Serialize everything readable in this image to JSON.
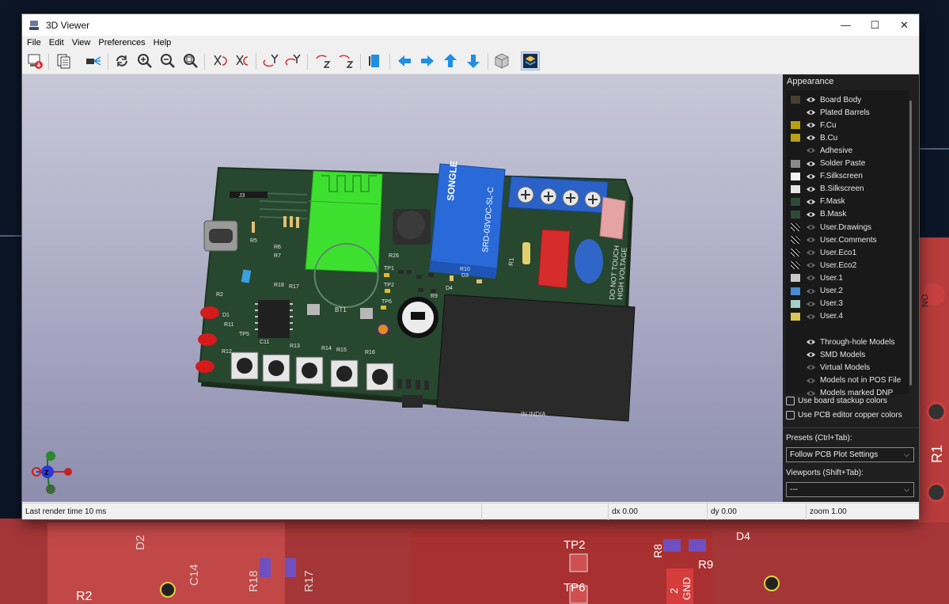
{
  "window": {
    "title": "3D Viewer",
    "minimize": "—",
    "maximize": "☐",
    "close": "✕"
  },
  "menu": [
    "File",
    "Edit",
    "View",
    "Preferences",
    "Help"
  ],
  "toolbar": {
    "icons": [
      "render-raytrace-icon",
      "copy-icon",
      "camera-icon",
      "reload-icon",
      "zoom-in-icon",
      "zoom-out-icon",
      "zoom-fit-icon",
      "rotate-x-cw-icon",
      "rotate-x-ccw-icon",
      "rotate-y-cw-icon",
      "rotate-y-ccw-icon",
      "rotate-z-cw-icon",
      "rotate-z-ccw-icon",
      "flip-board-icon",
      "pan-left-icon",
      "pan-right-icon",
      "pan-up-icon",
      "pan-down-icon",
      "ortho-icon",
      "layers-toggle-icon"
    ],
    "accent": "#1f8fe6"
  },
  "appearance": {
    "title": "Appearance",
    "layers": [
      {
        "label": "Board Body",
        "color": "#4a3f2f"
      },
      {
        "label": "Plated Barrels",
        "color": ""
      },
      {
        "label": "F.Cu",
        "color": "#b8a015"
      },
      {
        "label": "B.Cu",
        "color": "#b8a015"
      },
      {
        "label": "Adhesive",
        "color": ""
      },
      {
        "label": "Solder Paste",
        "color": "#8a8a8a"
      },
      {
        "label": "F.Silkscreen",
        "color": "#f0f0f0"
      },
      {
        "label": "B.Silkscreen",
        "color": "#e6e6e6"
      },
      {
        "label": "F.Mask",
        "color": "#2e4a3c"
      },
      {
        "label": "B.Mask",
        "color": "#2e4a3c"
      },
      {
        "label": "User.Drawings",
        "color": "checker"
      },
      {
        "label": "User.Comments",
        "color": "checker"
      },
      {
        "label": "User.Eco1",
        "color": "checker"
      },
      {
        "label": "User.Eco2",
        "color": "checker"
      },
      {
        "label": "User.1",
        "color": "#c8c8c8"
      },
      {
        "label": "User.2",
        "color": "#4a8ad0"
      },
      {
        "label": "User.3",
        "color": "#a0d0c8"
      },
      {
        "label": "User.4",
        "color": "#d8c850"
      }
    ],
    "models": [
      "Through-hole Models",
      "SMD Models",
      "Virtual Models",
      "Models not in POS File",
      "Models marked DNP"
    ],
    "use_stackup_colors": "Use board stackup colors",
    "use_copper_colors": "Use PCB editor copper colors",
    "presets_label": "Presets (Ctrl+Tab):",
    "presets_value": "Follow PCB Plot Settings",
    "viewports_label": "Viewports (Shift+Tab):",
    "viewports_value": "---"
  },
  "status": {
    "render_time": "Last render time 10 ms",
    "dx": "dx 0.00",
    "dy": "dy 0.00",
    "zoom": "zoom 1.00"
  },
  "board": {
    "silk": [
      "SONGLE",
      "SRD-03VDC-SL-C",
      "DO NOT TOUCH",
      "HIGH VOLTAGE",
      "IN INDIA",
      "BT1",
      "J3",
      "R1",
      "D3",
      "D4",
      "R9",
      "R10",
      "R26",
      "TP1",
      "TP2",
      "TP5",
      "TP6",
      "C11",
      "R13",
      "R14",
      "R15",
      "R16",
      "R18",
      "R17",
      "R2",
      "R5",
      "R6",
      "R7",
      "R11",
      "R12",
      "D1"
    ]
  },
  "background_labels": [
    "D2",
    "C14",
    "R2",
    "R18",
    "R17",
    "TP2",
    "TP6",
    "R8",
    "R9",
    "D4",
    "GND",
    "2",
    "R1",
    "NO"
  ]
}
